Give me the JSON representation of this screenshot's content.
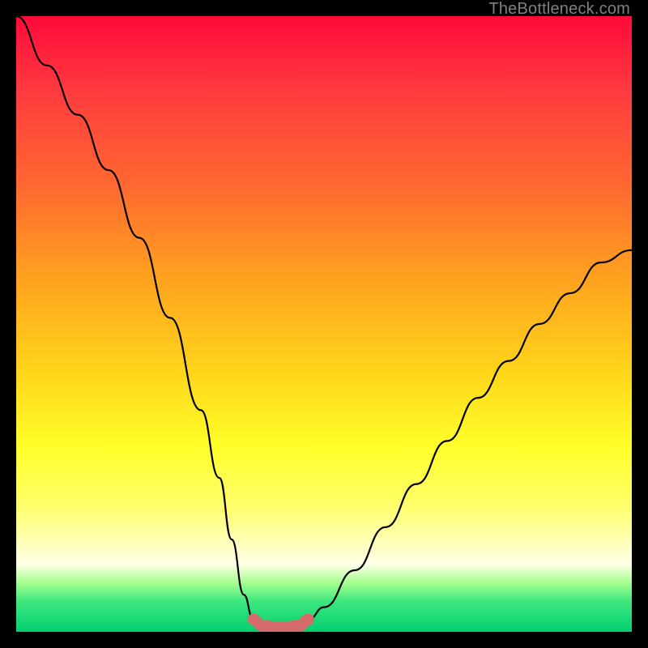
{
  "watermark": "TheBottleneck.com",
  "colors": {
    "accent_floor": "#d66b6b",
    "curve": "#000000",
    "gradient_top": "#ff0a3a",
    "gradient_bottom": "#00d070"
  },
  "chart_data": {
    "type": "line",
    "title": "",
    "xlabel": "",
    "ylabel": "",
    "xlim": [
      0,
      100
    ],
    "ylim": [
      0,
      100
    ],
    "grid": false,
    "series": [
      {
        "name": "left_curve",
        "x": [
          0,
          5,
          10,
          15,
          20,
          25,
          30,
          33,
          35,
          37,
          38.5
        ],
        "values": [
          100,
          92,
          84,
          75,
          64,
          51,
          36,
          25,
          15,
          6,
          2
        ]
      },
      {
        "name": "floor",
        "x": [
          38.5,
          40,
          42,
          44,
          46,
          47.5
        ],
        "values": [
          2,
          1,
          0.8,
          0.8,
          1,
          2
        ]
      },
      {
        "name": "right_curve",
        "x": [
          47.5,
          50,
          55,
          60,
          65,
          70,
          75,
          80,
          85,
          90,
          95,
          100
        ],
        "values": [
          2,
          4,
          10,
          17,
          24,
          31,
          38,
          44,
          50,
          55,
          60,
          62
        ]
      }
    ],
    "annotations": []
  }
}
